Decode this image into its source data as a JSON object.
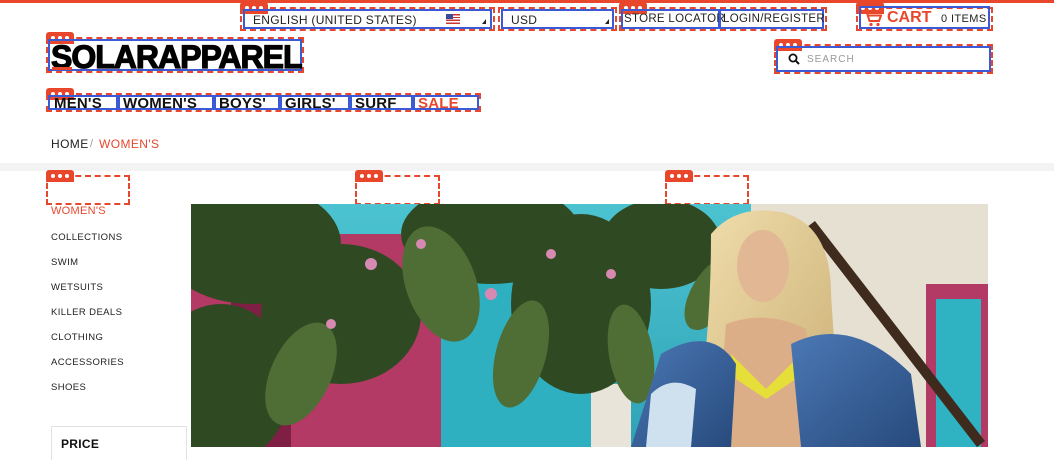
{
  "topbar": {
    "language": {
      "selected": "ENGLISH (UNITED STATES)",
      "flag_icon": "us-flag-icon"
    },
    "currency": {
      "selected": "USD"
    },
    "store_locator": "STORE LOCATOR",
    "login_register": "LOGIN/REGISTER",
    "cart": {
      "label": "CART",
      "count": "0 ITEMS",
      "icon": "shopping-cart-icon"
    }
  },
  "logo": {
    "text": "SOLARAPPAREL"
  },
  "search": {
    "placeholder": "SEARCH",
    "icon": "search-icon"
  },
  "nav": {
    "items": [
      {
        "label": "MEN'S"
      },
      {
        "label": "WOMEN'S"
      },
      {
        "label": "BOYS'"
      },
      {
        "label": "GIRLS'"
      },
      {
        "label": "SURF"
      },
      {
        "label": "SALE"
      }
    ]
  },
  "breadcrumb": {
    "home": "HOME",
    "separator": "/",
    "current": "WOMEN'S"
  },
  "sidebar": {
    "heading": "WOMEN'S",
    "items": [
      {
        "label": "COLLECTIONS"
      },
      {
        "label": "SWIM"
      },
      {
        "label": "WETSUITS"
      },
      {
        "label": "KILLER DEALS"
      },
      {
        "label": "CLOTHING"
      },
      {
        "label": "ACCESSORIES"
      },
      {
        "label": "SHOES"
      }
    ],
    "filter_heading": "PRICE"
  },
  "colors": {
    "accent": "#e8472c",
    "edit_inner_border": "#3b5bd6",
    "text": "#111111"
  }
}
